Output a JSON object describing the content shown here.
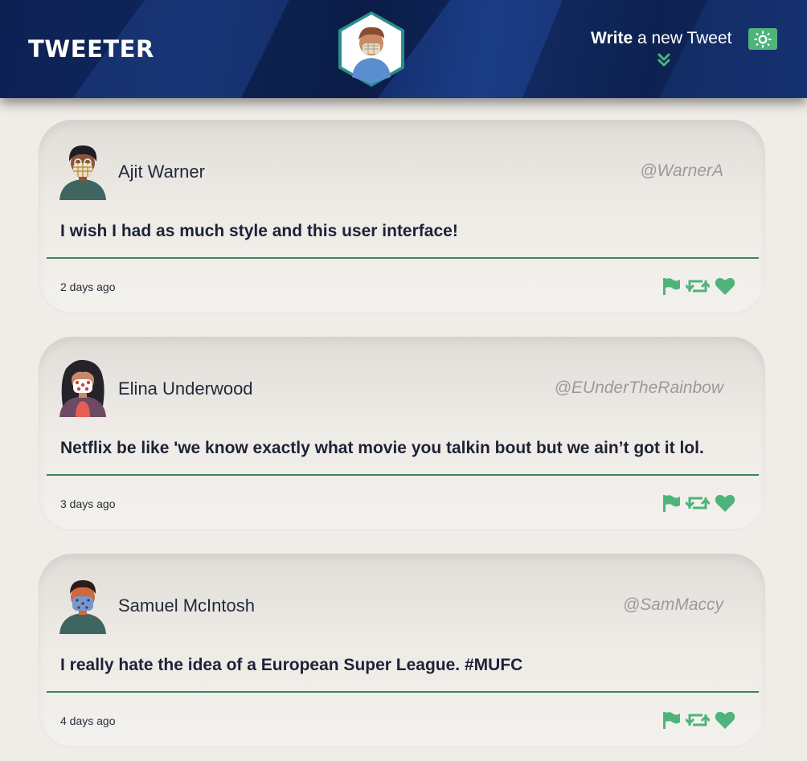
{
  "header": {
    "brand": "TWEETER",
    "compose_bold": "Write",
    "compose_rest": " a new Tweet"
  },
  "colors": {
    "nav": "#132c66",
    "accent": "#4fb37c",
    "divider": "#3b8460",
    "page": "#f0ede8"
  },
  "tweets": [
    {
      "name": "Ajit Warner",
      "handle": "@WarnerA",
      "text": "I wish I had as much style and this user interface!",
      "time": "2 days ago"
    },
    {
      "name": "Elina Underwood",
      "handle": "@EUnderTheRainbow",
      "text": "Netflix be like 'we know exactly what movie you talkin bout but we ain’t got it lol.",
      "time": "3 days ago"
    },
    {
      "name": "Samuel McIntosh",
      "handle": "@SamMaccy",
      "text": "I really hate the idea of a European Super League. #MUFC",
      "time": "4 days ago"
    }
  ],
  "icons": {
    "flag": "flag-icon",
    "retweet": "retweet-icon",
    "like": "heart-icon",
    "theme": "sun-icon",
    "compose_toggle": "double-chevron-down-icon"
  }
}
